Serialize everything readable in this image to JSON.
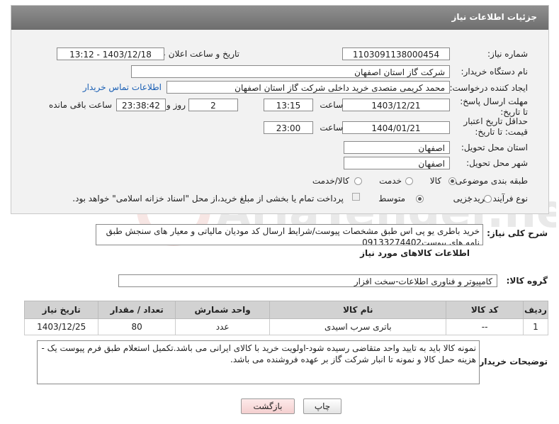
{
  "header": {
    "title": "جزئیات اطلاعات نیاز"
  },
  "form": {
    "need_number_label": "شماره نیاز:",
    "need_number": "1103091138000454",
    "announce_label": "تاریخ و ساعت اعلان عمومی:",
    "announce_value": "1403/12/18 - 13:12",
    "buyer_org_label": "نام دستگاه خریدار:",
    "buyer_org": "شرکت گاز استان اصفهان",
    "requester_label": "ایجاد کننده درخواست:",
    "requester": "محمد کریمی متصدی خرید داخلی شرکت گاز استان اصفهان",
    "contact_link": "اطلاعات تماس خریدار",
    "reply_deadline_label": "مهلت ارسال پاسخ: تا تاریخ:",
    "reply_date": "1403/12/21",
    "time_label": "ساعت",
    "reply_time": "13:15",
    "days_value": "2",
    "days_label": "روز و",
    "remaining_time": "23:38:42",
    "remaining_label": "ساعت باقی مانده",
    "price_validity_label": "حداقل تاریخ اعتبار قیمت: تا تاریخ:",
    "price_date": "1404/01/21",
    "price_time": "23:00",
    "province_label": "استان محل تحویل:",
    "province": "اصفهان",
    "city_label": "شهر محل تحویل:",
    "city": "اصفهان",
    "category_label": "طبقه بندی موضوعی:",
    "category_options": [
      "کالا",
      "خدمت",
      "کالا/خدمت"
    ],
    "category_selected": "کالا",
    "process_label": "نوع فرآیند خرید :",
    "process_options": [
      "جزیی",
      "متوسط"
    ],
    "process_selected": "متوسط",
    "payment_note": "پرداخت تمام یا بخشی از مبلغ خرید،از محل \"اسناد خزانه اسلامی\" خواهد بود."
  },
  "description": {
    "label": "شرح کلی نیاز:",
    "text": "خرید باطری یو پی اس طبق مشخصات پیوست/شرایط ارسال کد مودیان مالیاتی و معیار های سنجش طبق نامه های پیوست09133274402"
  },
  "goods": {
    "section_title": "اطلاعات کالاهای مورد نیاز",
    "group_label": "گروه کالا:",
    "group_value": "کامپیوتر و فناوری اطلاعات-سخت افزار",
    "columns": [
      "ردیف",
      "کد کالا",
      "نام کالا",
      "واحد شمارش",
      "تعداد / مقدار",
      "تاریخ نیاز"
    ],
    "rows": [
      [
        "1",
        "--",
        "باتری سرب اسیدی",
        "عدد",
        "80",
        "1403/12/25"
      ]
    ]
  },
  "buyer_notes": {
    "label": "توضیحات خریدار:",
    "text": "نمونه کالا باید به تایید واحد متقاضی رسیده شود-اولویت خرید با کالای ایرانی می باشد.تکمیل استعلام طبق فرم پیوست یک - هزینه حمل کالا و نمونه تا انبار شرکت گاز بر عهده فروشنده می باشد."
  },
  "buttons": {
    "print": "چاپ",
    "back": "بازگشت"
  },
  "watermark": {
    "text": "AriaTender.neT"
  }
}
